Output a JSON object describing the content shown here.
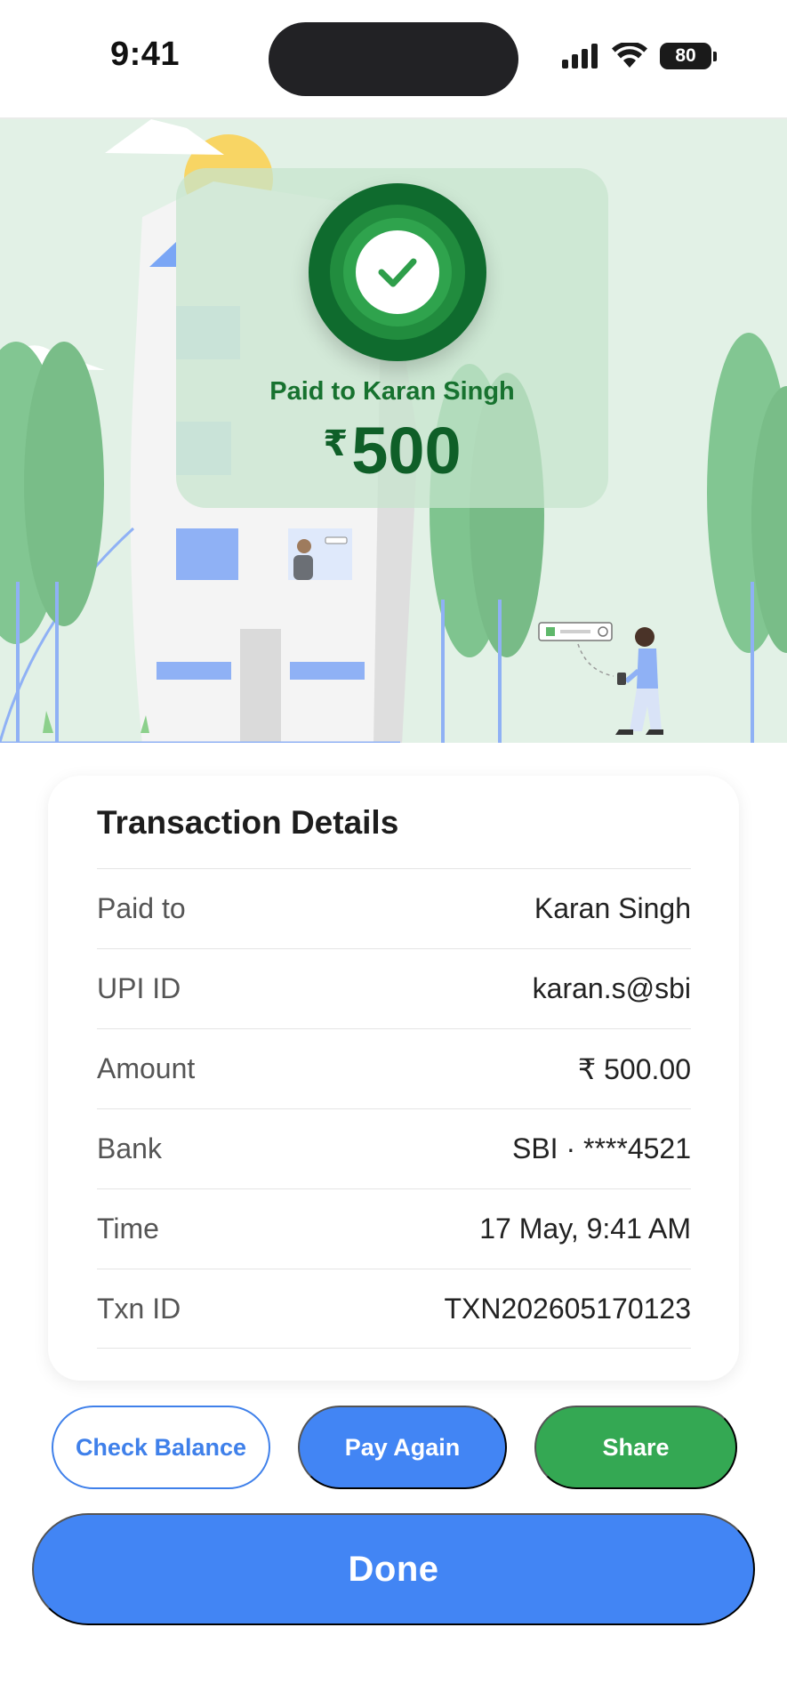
{
  "status_bar": {
    "time": "9:41",
    "battery_level": "80",
    "icons": [
      "signal-icon",
      "wifi-icon",
      "battery-icon"
    ]
  },
  "hero": {
    "paid_to_text": "Paid to Karan Singh",
    "currency_symbol": "₹",
    "amount": "500",
    "icon": "checkmark-icon"
  },
  "details": {
    "title": "Transaction Details",
    "rows": [
      {
        "label": "Paid to",
        "value": "Karan Singh"
      },
      {
        "label": "UPI ID",
        "value": "karan.s@sbi"
      },
      {
        "label": "Amount",
        "value": "₹ 500.00"
      },
      {
        "label": "Bank",
        "value": "SBI · ****4521"
      },
      {
        "label": "Time",
        "value": "17 May, 9:41 AM"
      },
      {
        "label": "Txn ID",
        "value": "TXN202605170123"
      }
    ]
  },
  "actions": {
    "check_balance": "Check Balance",
    "pay_again": "Pay Again",
    "share": "Share",
    "done": "Done"
  },
  "colors": {
    "primary_blue": "#4285f4",
    "success_green": "#34a853",
    "dark_green": "#0f6b2e",
    "hero_bg": "#e2f1e6"
  }
}
